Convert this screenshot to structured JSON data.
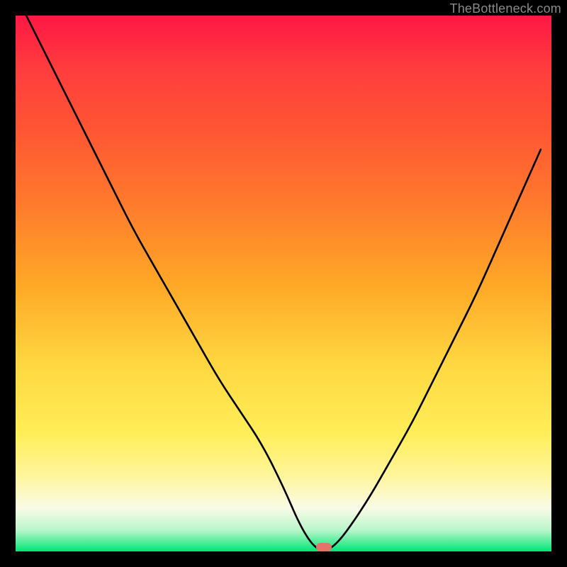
{
  "watermark": "TheBottleneck.com",
  "marker": {
    "x_pct": 57.5,
    "y_pct": 99.2
  },
  "chart_data": {
    "type": "line",
    "title": "",
    "xlabel": "",
    "ylabel": "",
    "xlim": [
      0,
      100
    ],
    "ylim": [
      0,
      100
    ],
    "series": [
      {
        "name": "bottleneck-curve",
        "x": [
          2,
          6,
          10,
          14,
          18,
          22,
          26,
          30,
          34,
          38,
          42,
          46,
          50,
          53,
          55.5,
          57.5,
          59.5,
          62,
          66,
          70,
          74,
          78,
          82,
          86,
          90,
          94,
          98
        ],
        "y": [
          100,
          92,
          84,
          76,
          68,
          60,
          53,
          46,
          39,
          32,
          26,
          20,
          12,
          5,
          1,
          0,
          1,
          4,
          10,
          17,
          24,
          32,
          40,
          48,
          57,
          66,
          75
        ]
      }
    ],
    "background_gradient": {
      "top": "#ff1744",
      "mid": "#ffd740",
      "bottom": "#00e676"
    },
    "marker_point": {
      "x": 57.5,
      "y": 0,
      "color": "#e57368"
    }
  }
}
